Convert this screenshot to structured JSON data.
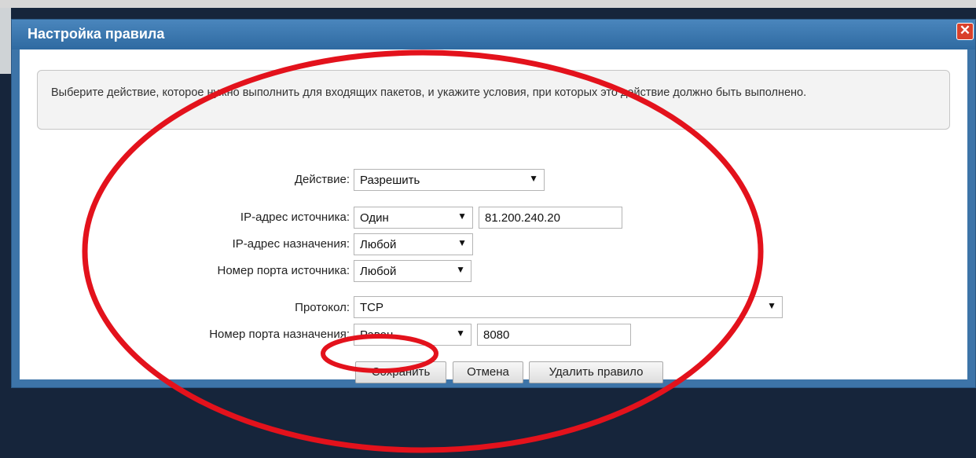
{
  "dialog": {
    "title": "Настройка правила",
    "close_label": "✕"
  },
  "info": {
    "text": "Выберите действие, которое нужно выполнить для входящих пакетов, и укажите условия, при которых это действие должно быть выполнено."
  },
  "form": {
    "action": {
      "label": "Действие:",
      "value": "Разрешить"
    },
    "source_ip": {
      "label": "IP-адрес источника:",
      "mode": "Один",
      "value": "81.200.240.20"
    },
    "dest_ip": {
      "label": "IP-адрес назначения:",
      "mode": "Любой"
    },
    "source_port": {
      "label": "Номер порта источника:",
      "mode": "Любой"
    },
    "protocol": {
      "label": "Протокол:",
      "value": "TCP"
    },
    "dest_port": {
      "label": "Номер порта назначения:",
      "mode": "Равен",
      "value": "8080"
    }
  },
  "buttons": {
    "save": "Сохранить",
    "cancel": "Отмена",
    "delete": "Удалить правило"
  },
  "icons": {
    "dropdown": "chevron-down-icon",
    "close": "close-icon"
  },
  "colors": {
    "titlebar": "#3d74a8",
    "close": "#d9412b",
    "annotation": "#e3121c",
    "background": "#16253b"
  }
}
